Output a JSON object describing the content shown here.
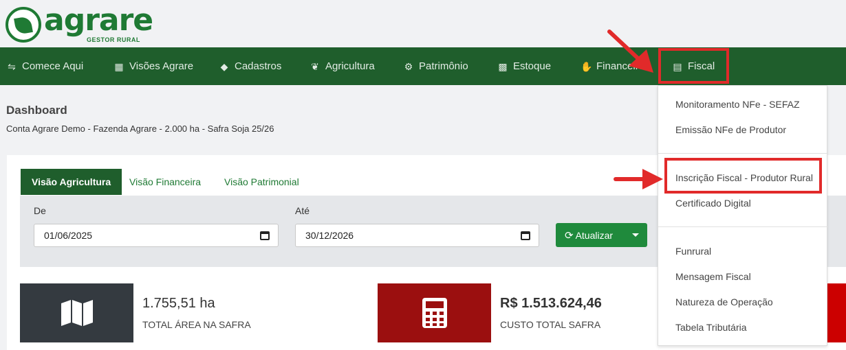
{
  "brand": {
    "name": "agrare",
    "tagline": "GESTOR RURAL"
  },
  "nav": {
    "items": [
      {
        "label": "Comece Aqui",
        "icon": "handshake-icon"
      },
      {
        "label": "Visões Agrare",
        "icon": "grid-icon"
      },
      {
        "label": "Cadastros",
        "icon": "tag-icon"
      },
      {
        "label": "Agricultura",
        "icon": "leaf-icon"
      },
      {
        "label": "Patrimônio",
        "icon": "tractor-icon"
      },
      {
        "label": "Estoque",
        "icon": "boxes-icon"
      },
      {
        "label": "Financeiro",
        "icon": "hand-coin-icon"
      },
      {
        "label": "Fiscal",
        "icon": "document-icon"
      }
    ]
  },
  "page": {
    "title": "Dashboard",
    "subtitle": "Conta Agrare Demo - Fazenda Agrare - 2.000 ha - Safra Soja 25/26"
  },
  "tabs": [
    {
      "label": "Visão Agricultura",
      "active": true
    },
    {
      "label": "Visão Financeira",
      "active": false
    },
    {
      "label": "Visão Patrimonial",
      "active": false
    }
  ],
  "filters": {
    "from_label": "De",
    "from_value": "01/06/2025",
    "to_label": "Até",
    "to_value": "30/12/2026",
    "refresh_label": "Atualizar"
  },
  "stats": [
    {
      "value": "1.755,51 ha",
      "label": "TOTAL ÁREA NA SAFRA",
      "icon": "map-icon",
      "color": "#343a40"
    },
    {
      "value": "R$ 1.513.624,46",
      "label": "CUSTO TOTAL SAFRA",
      "icon": "calculator-icon",
      "color": "#9b0f0f"
    }
  ],
  "fiscal_menu": {
    "groups": [
      [
        "Monitoramento NFe - SEFAZ",
        "Emissão NFe de Produtor"
      ],
      [
        "Inscrição Fiscal - Produtor Rural",
        "Certificado Digital"
      ],
      [
        "Funrural",
        "Mensagem Fiscal",
        "Natureza de Operação",
        "Tabela Tributária"
      ]
    ]
  },
  "colors": {
    "primary": "#1f5e2c",
    "brand": "#1f7a34",
    "button": "#1f8a3c",
    "annotation": "#e12a2a"
  }
}
